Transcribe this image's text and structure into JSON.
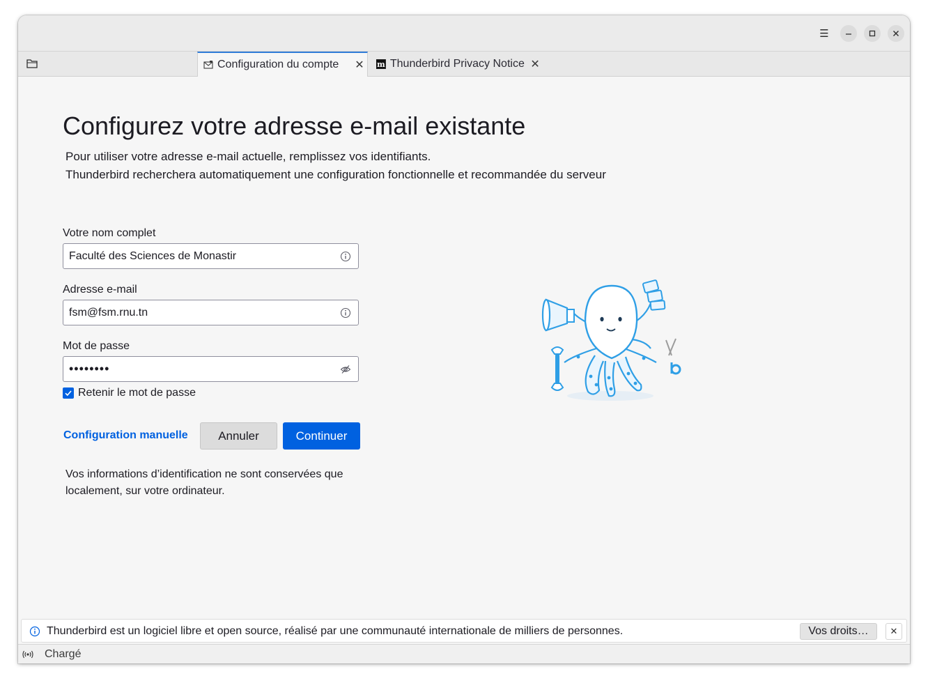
{
  "window_controls": {
    "menu_icon": "hamburger-icon",
    "minimize_icon": "minimize-icon",
    "maximize_icon": "maximize-icon",
    "close_icon": "close-icon"
  },
  "tabs": [
    {
      "label": "Configuration du compte",
      "icon": "envelope-icon",
      "active": true,
      "close": "✕"
    },
    {
      "label": "Thunderbird Privacy Notice",
      "icon": "mozilla-m-icon",
      "active": false,
      "close": "✕"
    }
  ],
  "main": {
    "heading": "Configurez votre adresse e-mail existante",
    "subtitle_line1": "Pour utiliser votre adresse e-mail actuelle, remplissez vos identifiants.",
    "subtitle_line2": "Thunderbird recherchera automatiquement une configuration fonctionnelle et recommandée du serveur",
    "fields": {
      "name_label": "Votre nom complet",
      "name_value": "Faculté des Sciences de Monastir",
      "email_label": "Adresse e-mail",
      "email_value": "fsm@fsm.rnu.tn",
      "password_label": "Mot de passe",
      "password_value": "••••••••"
    },
    "remember_password": {
      "label": "Retenir le mot de passe",
      "checked": true
    },
    "manual_config_link": "Configuration manuelle",
    "cancel_button": "Annuler",
    "continue_button": "Continuer",
    "note_line1": "Vos informations d’identification ne sont conservées que",
    "note_line2": "localement, sur votre ordinateur."
  },
  "notification": {
    "text": "Thunderbird est un logiciel libre et open source, réalisé par une communauté internationale de milliers de personnes.",
    "button": "Vos droits…",
    "close": "✕"
  },
  "status": {
    "text": "Chargé"
  },
  "colors": {
    "accent": "#0061e0",
    "tab_indicator": "#2f7cd8",
    "illustration": "#2f9fe6"
  }
}
